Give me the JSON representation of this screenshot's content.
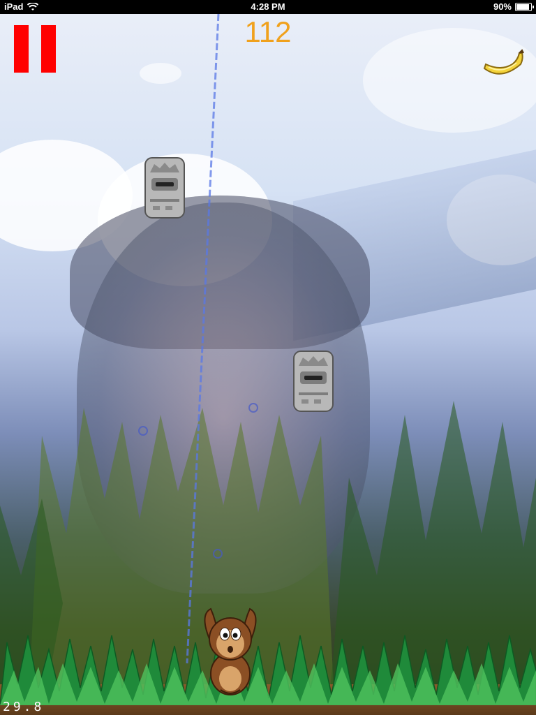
{
  "status_bar": {
    "device": "iPad",
    "time": "4:28 PM",
    "battery": "90%",
    "battery_level": 0.9
  },
  "hud": {
    "score": "112",
    "fps": "29.8",
    "pause_color": "#ff0000",
    "score_color": "#f0a11c"
  },
  "icons": {
    "pause": "pause-icon",
    "banana": "banana-icon",
    "wifi": "wifi-icon",
    "battery": "battery-icon",
    "obstacle": "stone-totem-icon",
    "player": "monkey-icon"
  }
}
